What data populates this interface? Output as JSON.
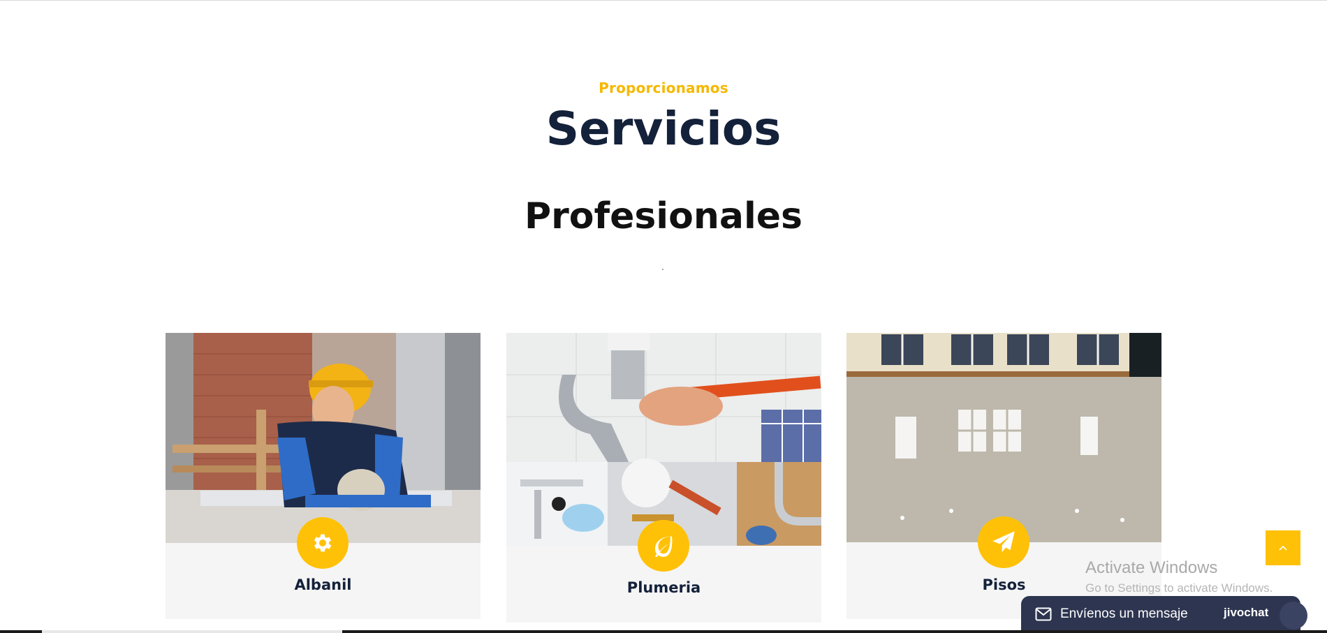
{
  "section": {
    "eyebrow": "Proporcionamos",
    "title": "Servicios",
    "subtitle": "Profesionales"
  },
  "services": [
    {
      "label": "Albanil",
      "icon": "gear-icon"
    },
    {
      "label": "Plumeria",
      "icon": "leaf-icon"
    },
    {
      "label": "Pisos",
      "icon": "paper-plane-icon"
    }
  ],
  "activation_notice": {
    "title": "Activate Windows",
    "subtitle": "Go to Settings to activate Windows."
  },
  "chat_widget": {
    "message": "Envíenos un mensaje",
    "brand": "jivochat"
  },
  "colors": {
    "accent": "#ffc107",
    "eyebrow": "#f5b800",
    "heading": "#14213a",
    "card_bg": "#f5f5f5",
    "chat_bg": "#2d3550"
  }
}
